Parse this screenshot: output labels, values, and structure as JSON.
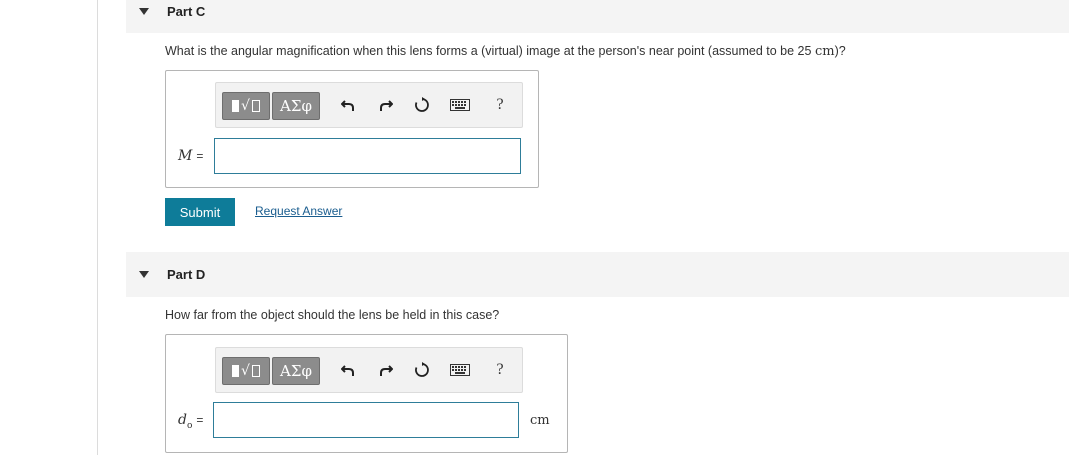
{
  "partC": {
    "title": "Part C",
    "question_pre": "What is the angular magnification when this lens forms a (virtual) image at the person's near point (assumed to be 25 ",
    "question_unit": "cm",
    "question_post": ")?",
    "variable": "M",
    "equals": "=",
    "input_value": "",
    "toolbar": {
      "greek_label": "ΑΣφ",
      "help_label": "?"
    },
    "submit_label": "Submit",
    "request_label": "Request Answer"
  },
  "partD": {
    "title": "Part D",
    "question": "How far from the object should the lens be held in this case?",
    "variable": "d",
    "variable_sub": "o",
    "equals": "=",
    "input_value": "",
    "unit": "cm",
    "toolbar": {
      "greek_label": "ΑΣφ",
      "help_label": "?"
    }
  }
}
